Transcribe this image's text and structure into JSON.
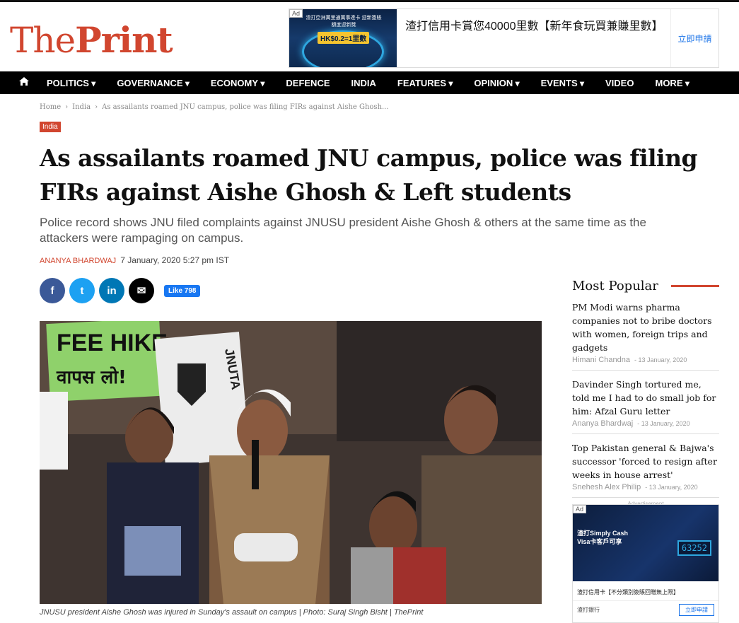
{
  "logo": {
    "part1": "The",
    "part2": "Print"
  },
  "top_ad": {
    "tag": "Ad",
    "image_text": "渣打亞洲萬里通萬事達卡\n迎新簽賬額度迎新獎",
    "image_highlight": "HK$0.2=1里數",
    "headline": "渣打信用卡賞您40000里數【新年食玩買兼賺里數】",
    "cta": "立即申請"
  },
  "nav": {
    "home_icon": "home-icon",
    "items": [
      {
        "label": "POLITICS",
        "dropdown": true
      },
      {
        "label": "GOVERNANCE",
        "dropdown": true
      },
      {
        "label": "ECONOMY",
        "dropdown": true
      },
      {
        "label": "DEFENCE",
        "dropdown": false
      },
      {
        "label": "INDIA",
        "dropdown": false
      },
      {
        "label": "FEATURES",
        "dropdown": true
      },
      {
        "label": "OPINION",
        "dropdown": true
      },
      {
        "label": "EVENTS",
        "dropdown": true
      },
      {
        "label": "VIDEO",
        "dropdown": false
      },
      {
        "label": "MORE",
        "dropdown": true
      }
    ]
  },
  "breadcrumb": {
    "home": "Home",
    "section": "India",
    "current": "As assailants roamed JNU campus, police was filing FIRs against Aishe Ghosh..."
  },
  "article": {
    "category": "India",
    "title": "As assailants roamed JNU campus, police was filing FIRs against Aishe Ghosh & Left students",
    "dek": "Police record shows JNU filed complaints against JNUSU president Aishe Ghosh & others at the same time as the attackers were rampaging on campus.",
    "author": "ANANYA BHARDWAJ",
    "date": "7 January, 2020 5:27 pm IST",
    "photo_signs": {
      "sign1": "FEE HIKE",
      "sign1_hindi": "वापस लो!",
      "sign2": "JNUTA"
    },
    "caption": "JNUSU president Aishe Ghosh was injured in Sunday's assault on campus | Photo: Suraj Singh Bisht | ThePrint"
  },
  "share": {
    "facebook": "f",
    "twitter": "t",
    "linkedin": "in",
    "email": "✉",
    "like_label": "Like 798"
  },
  "sidebar": {
    "title": "Most Popular",
    "items": [
      {
        "headline": "PM Modi warns pharma companies not to bribe doctors with women, foreign trips and gadgets",
        "author": "Himani Chandna",
        "date": "13 January, 2020"
      },
      {
        "headline": "Davinder Singh tortured me, told me I had to do small job for him: Afzal Guru letter",
        "author": "Ananya Bhardwaj",
        "date": "13 January, 2020"
      },
      {
        "headline": "Top Pakistan general & Bajwa's successor 'forced to resign after weeks in house arrest'",
        "author": "Snehesh Alex Philip",
        "date": "13 January, 2020"
      }
    ],
    "advert_label": "Advertisement"
  },
  "side_ad": {
    "tag": "Ad",
    "line1": "渣打Simply Cash",
    "line2": "Visa卡客戶可享",
    "counter": "63252",
    "text": "渣打信用卡【不分類別簽賬回贈無上限】",
    "brand": "渣打銀行",
    "cta": "立即申請"
  },
  "colors": {
    "brand_red": "#d1462f",
    "nav_bg": "#000000"
  }
}
